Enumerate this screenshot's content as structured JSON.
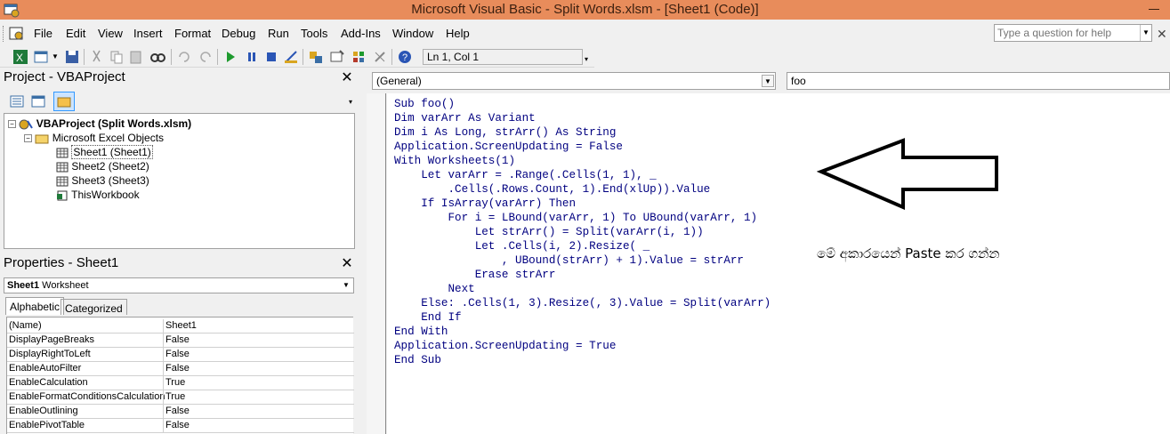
{
  "window": {
    "title": "Microsoft Visual Basic - Split Words.xlsm - [Sheet1 (Code)]"
  },
  "menu": [
    "File",
    "Edit",
    "View",
    "Insert",
    "Format",
    "Debug",
    "Run",
    "Tools",
    "Add-Ins",
    "Window",
    "Help"
  ],
  "help": {
    "placeholder": "Type a question for help"
  },
  "toolbar": {
    "position": "Ln 1, Col 1"
  },
  "project": {
    "title": "Project - VBAProject",
    "root": "VBAProject (Split Words.xlsm)",
    "folder": "Microsoft Excel Objects",
    "items": [
      "Sheet1 (Sheet1)",
      "Sheet2 (Sheet2)",
      "Sheet3 (Sheet3)",
      "ThisWorkbook"
    ]
  },
  "properties": {
    "title": "Properties - Sheet1",
    "object_name": "Sheet1",
    "object_type": "Worksheet",
    "tabs": [
      "Alphabetic",
      "Categorized"
    ],
    "rows": [
      {
        "name": "(Name)",
        "value": "Sheet1"
      },
      {
        "name": "DisplayPageBreaks",
        "value": "False"
      },
      {
        "name": "DisplayRightToLeft",
        "value": "False"
      },
      {
        "name": "EnableAutoFilter",
        "value": "False"
      },
      {
        "name": "EnableCalculation",
        "value": "True"
      },
      {
        "name": "EnableFormatConditionsCalculation",
        "value": "True"
      },
      {
        "name": "EnableOutlining",
        "value": "False"
      },
      {
        "name": "EnablePivotTable",
        "value": "False"
      }
    ]
  },
  "code": {
    "object_combo": "(General)",
    "proc_combo": "foo",
    "lines": [
      "Sub foo()",
      "Dim varArr As Variant",
      "Dim i As Long, strArr() As String",
      "Application.ScreenUpdating = False",
      "With Worksheets(1)",
      "    Let varArr = .Range(.Cells(1, 1), _",
      "        .Cells(.Rows.Count, 1).End(xlUp)).Value",
      "    If IsArray(varArr) Then",
      "        For i = LBound(varArr, 1) To UBound(varArr, 1)",
      "            Let strArr() = Split(varArr(i, 1))",
      "            Let .Cells(i, 2).Resize( _",
      "                , UBound(strArr) + 1).Value = strArr",
      "            Erase strArr",
      "        Next",
      "    Else: .Cells(1, 3).Resize(, 3).Value = Split(varArr)",
      "    End If",
      "End With",
      "Application.ScreenUpdating = True",
      "End Sub"
    ]
  },
  "annotation": {
    "text": "මේ අකාරයෙන් Paste කර ගන්න"
  }
}
